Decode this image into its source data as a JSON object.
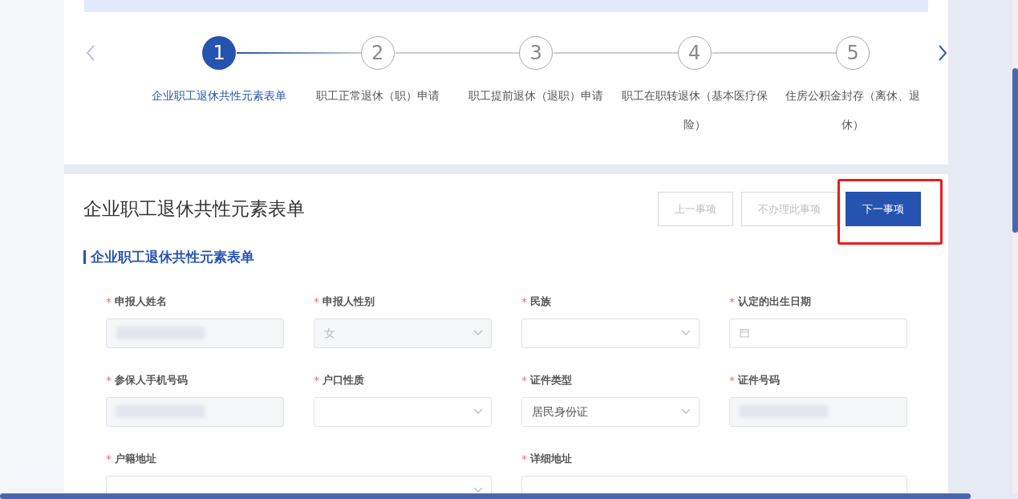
{
  "steps": [
    {
      "number": "1",
      "label": "企业职工退休共性元素表单",
      "selected": true
    },
    {
      "number": "2",
      "label": "职工正常退休（职）申请",
      "selected": false
    },
    {
      "number": "3",
      "label": "职工提前退休（退职）申请",
      "selected": false
    },
    {
      "number": "4",
      "label": "职工在职转退休（基本医疗保险）",
      "selected": false
    },
    {
      "number": "5",
      "label": "住房公积金封存（离休、退休）",
      "selected": false
    }
  ],
  "form": {
    "title": "企业职工退休共性元素表单",
    "buttons": [
      {
        "label": "上一事项",
        "kind": "secondary",
        "disabled": true
      },
      {
        "label": "不办理此事项",
        "kind": "secondary",
        "disabled": true
      },
      {
        "label": "下一事项",
        "kind": "primary",
        "disabled": false,
        "highlighted": true
      }
    ],
    "section_title": "企业职工退休共性元素表单",
    "required_mark": "*",
    "fields": [
      {
        "label": "申报人姓名",
        "required": true,
        "kind": "input",
        "disabled": true,
        "redacted": true,
        "wide": false
      },
      {
        "label": "申报人性别",
        "required": true,
        "kind": "select",
        "disabled": true,
        "value": "女",
        "wide": false
      },
      {
        "label": "民族",
        "required": true,
        "kind": "select",
        "disabled": false,
        "wide": false
      },
      {
        "label": "认定的出生日期",
        "required": true,
        "kind": "date",
        "disabled": false,
        "wide": false
      },
      {
        "label": "参保人手机号码",
        "required": true,
        "kind": "input",
        "disabled": true,
        "redacted": true,
        "wide": false
      },
      {
        "label": "户口性质",
        "required": true,
        "kind": "select",
        "disabled": false,
        "wide": false
      },
      {
        "label": "证件类型",
        "required": true,
        "kind": "select",
        "disabled": false,
        "value": "居民身份证",
        "wide": false
      },
      {
        "label": "证件号码",
        "required": true,
        "kind": "input",
        "disabled": true,
        "redacted": true,
        "wide": false
      },
      {
        "label": "户籍地址",
        "required": true,
        "kind": "select",
        "disabled": false,
        "wide": true
      },
      {
        "label": "详细地址",
        "required": true,
        "kind": "input",
        "disabled": false,
        "wide": true
      }
    ]
  }
}
